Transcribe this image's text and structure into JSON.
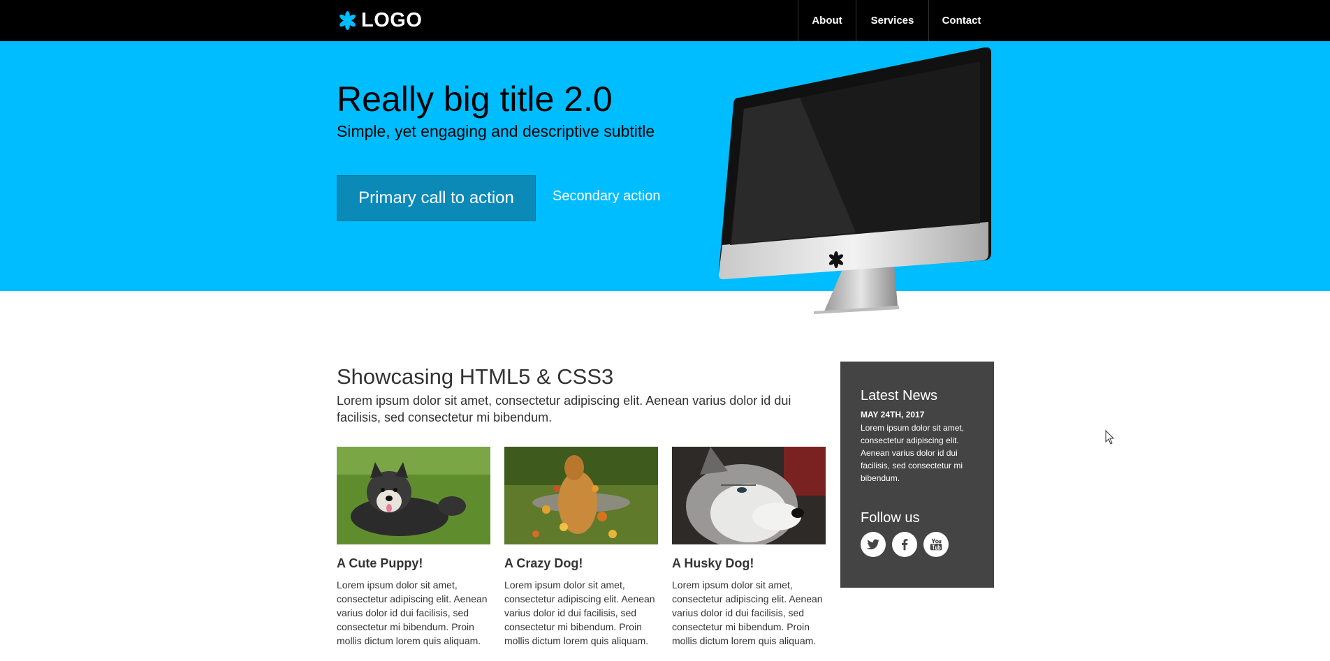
{
  "header": {
    "logo_text": "LOGO",
    "nav": [
      {
        "label": "About"
      },
      {
        "label": "Services"
      },
      {
        "label": "Contact"
      }
    ]
  },
  "hero": {
    "title": "Really big title 2.0",
    "subtitle": "Simple, yet engaging and descriptive subtitle",
    "primary_cta": "Primary call to action",
    "secondary_cta": "Secondary action",
    "image": "imac-monitor"
  },
  "showcase": {
    "title": "Showcasing HTML5 & CSS3",
    "text": "Lorem ipsum dolor sit amet, consectetur adipiscing elit. Aenean varius dolor id dui facilisis, sed consectetur mi bibendum.",
    "cards": [
      {
        "title": "A Cute Puppy!",
        "text": "Lorem ipsum dolor sit amet, consectetur adipiscing elit. Aenean varius dolor id dui facilisis, sed consectetur mi bibendum. Proin mollis dictum lorem quis aliquam.",
        "image": "puppy-on-grass"
      },
      {
        "title": "A Crazy Dog!",
        "text": "Lorem ipsum dolor sit amet, consectetur adipiscing elit. Aenean varius dolor id dui facilisis, sed consectetur mi bibendum. Proin mollis dictum lorem quis aliquam.",
        "image": "dog-jumping-in-leaves"
      },
      {
        "title": "A Husky Dog!",
        "text": "Lorem ipsum dolor sit amet, consectetur adipiscing elit. Aenean varius dolor id dui facilisis, sed consectetur mi bibendum. Proin mollis dictum lorem quis aliquam.",
        "image": "husky-portrait"
      }
    ]
  },
  "sidebar": {
    "news_title": "Latest News",
    "news_date": "MAY 24TH, 2017",
    "news_text": "Lorem ipsum dolor sit amet, consectetur adipiscing elit. Aenean varius dolor id dui facilisis, sed consectetur mi bibendum.",
    "follow_title": "Follow us",
    "socials": [
      "twitter-icon",
      "facebook-icon",
      "youtube-icon"
    ]
  },
  "colors": {
    "topbar": "#000000",
    "hero": "#00bdff",
    "primary_button": "#0b8ab8",
    "sidebar": "#444444",
    "text": "#333333"
  }
}
